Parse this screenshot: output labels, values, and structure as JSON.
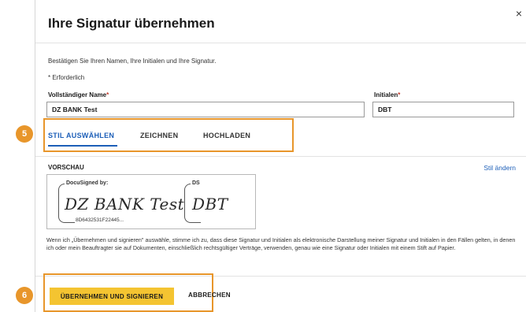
{
  "dialog": {
    "close_glyph": "×",
    "title": "Ihre Signatur übernehmen",
    "intro": "Bestätigen Sie Ihren Namen, Ihre Initialen und Ihre Signatur.",
    "required_note": "* Erforderlich"
  },
  "form": {
    "full_name_label": "Vollständiger Name",
    "full_name_value": "DZ BANK Test",
    "initials_label": "Initialen",
    "initials_value": "DBT",
    "required_marker": "*"
  },
  "tabs": [
    {
      "label": "STIL AUSWÄHLEN",
      "active": true
    },
    {
      "label": "ZEICHNEN",
      "active": false
    },
    {
      "label": "HOCHLADEN",
      "active": false
    }
  ],
  "preview": {
    "label": "VORSCHAU",
    "change_style": "Stil ändern",
    "signature_caption": "DocuSigned by:",
    "signature_text": "DZ BANK Test",
    "signature_hash": "8D6432531F22445...",
    "initials_caption": "DS",
    "initials_text": "DBT"
  },
  "legal_text": "Wenn ich „Übernehmen und signieren\" auswähle, stimme ich zu, dass diese Signatur und Initialen als elektronische Darstellung meiner Signatur und Initialen in den Fällen gelten, in denen ich oder mein Beauftragter sie auf Dokumenten, einschließlich rechtsgültiger Verträge, verwenden, genau wie eine Signatur oder Initialen mit einem Stift auf Papier.",
  "buttons": {
    "adopt_sign": "ÜBERNEHMEN UND SIGNIEREN",
    "cancel": "ABBRECHEN"
  },
  "annotations": {
    "step_tabs": "5",
    "step_button": "6"
  },
  "colors": {
    "accent_blue": "#1d5fb8",
    "primary_yellow": "#f4c431",
    "highlight_orange": "#e8962b"
  }
}
